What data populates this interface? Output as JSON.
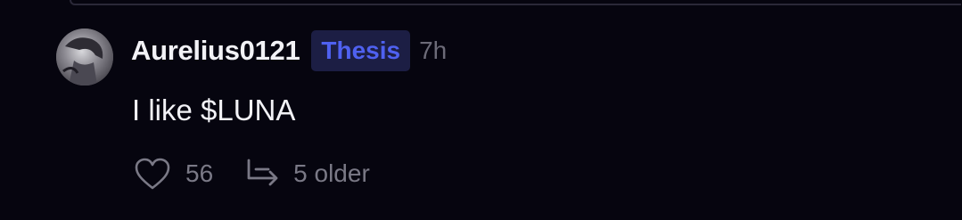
{
  "comment": {
    "username": "Aurelius0121",
    "badge": "Thesis",
    "time": "7h",
    "text": "I like $LUNA",
    "likes": "56",
    "older_replies": "5 older"
  },
  "icons": {
    "like": "heart-icon",
    "replies": "reply-arrow-icon"
  },
  "colors": {
    "background": "#06050f",
    "badge_text": "#4f61f0",
    "badge_bg": "#1c1e44",
    "muted": "#7a7986"
  }
}
